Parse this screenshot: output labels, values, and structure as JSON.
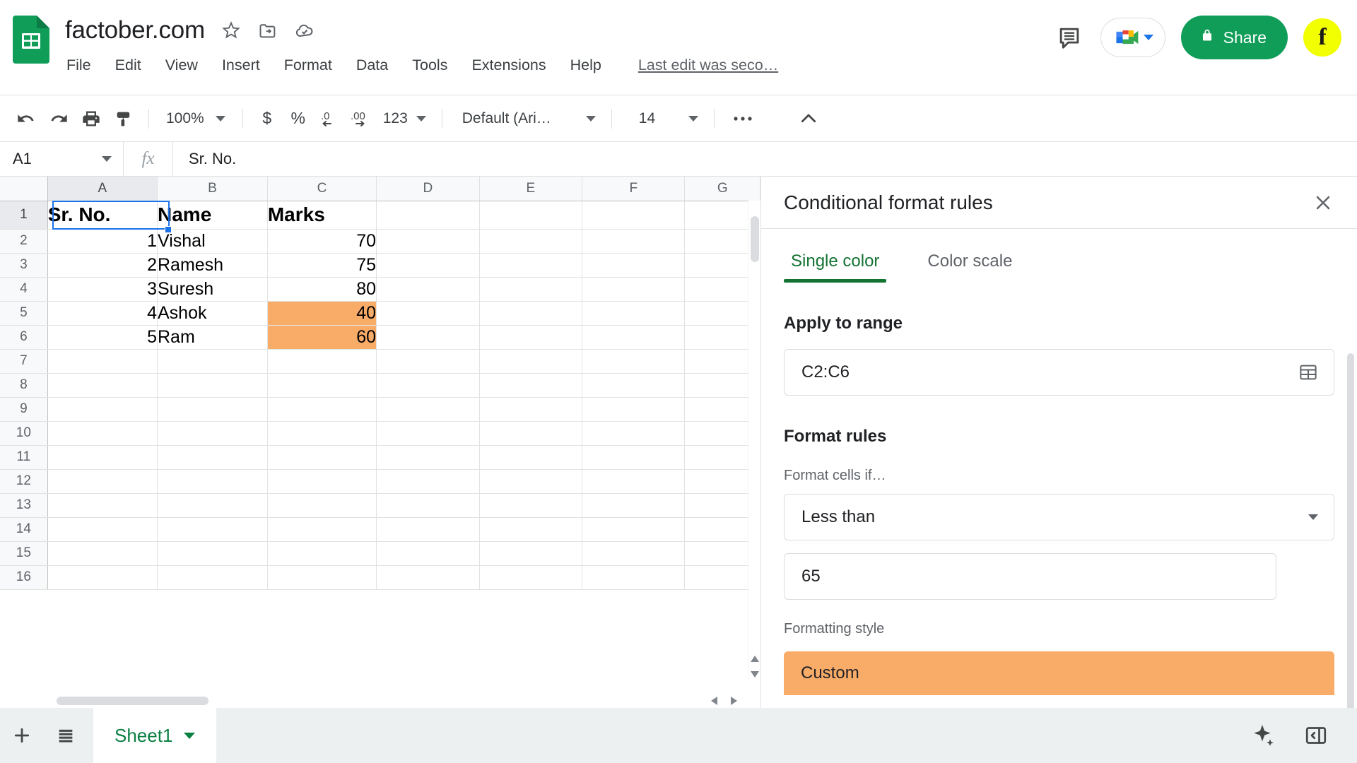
{
  "header": {
    "doc_title": "factober.com",
    "icons": [
      {
        "name": "star-icon",
        "label": "Star"
      },
      {
        "name": "move-to-folder-icon",
        "label": "Move"
      },
      {
        "name": "cloud-saved-icon",
        "label": "Saved to Drive"
      }
    ],
    "menus": [
      "File",
      "Edit",
      "View",
      "Insert",
      "Format",
      "Data",
      "Tools",
      "Extensions",
      "Help"
    ],
    "last_edit": "Last edit was seco…",
    "comment_icon": "comment-icon",
    "meet_icon": "google-meet-icon",
    "share_label": "Share",
    "share_lock_icon": "lock-icon",
    "share_color": "#0f9d58",
    "avatar_initial": "f",
    "avatar_color": "#f2ff00"
  },
  "toolbar": {
    "undo": "undo-icon",
    "redo": "redo-icon",
    "print": "print-icon",
    "paint": "paint-format-icon",
    "zoom_value": "100%",
    "currency": "$",
    "percent": "%",
    "decrease_decimal": ".0",
    "increase_decimal": ".00",
    "more_formats": "123",
    "font_family": "Default (Ari…",
    "font_size": "14",
    "more": "…",
    "collapse": "collapse-toolbar-icon"
  },
  "formula_bar": {
    "name_box": "A1",
    "fx_label": "fx",
    "formula_value": "Sr. No."
  },
  "grid": {
    "columns": [
      "A",
      "B",
      "C",
      "D",
      "E",
      "F",
      "G"
    ],
    "rows": [
      "1",
      "2",
      "3",
      "4",
      "5",
      "6",
      "7",
      "8",
      "9",
      "10",
      "11",
      "12",
      "13",
      "14",
      "15",
      "16"
    ],
    "active_cell": "A1",
    "highlight_color": "#f9ab68",
    "data": [
      {
        "row": "1",
        "a": "Sr. No.",
        "b": "Name",
        "c": "Marks",
        "header": true,
        "hl": false
      },
      {
        "row": "2",
        "a": "1",
        "b": "Vishal",
        "c": "70",
        "header": false,
        "hl": false
      },
      {
        "row": "3",
        "a": "2",
        "b": "Ramesh",
        "c": "75",
        "header": false,
        "hl": false
      },
      {
        "row": "4",
        "a": "3",
        "b": "Suresh",
        "c": "80",
        "header": false,
        "hl": false
      },
      {
        "row": "5",
        "a": "4",
        "b": "Ashok",
        "c": "40",
        "header": false,
        "hl": true
      },
      {
        "row": "6",
        "a": "5",
        "b": "Ram",
        "c": "60",
        "header": false,
        "hl": true
      },
      {
        "row": "7",
        "a": "",
        "b": "",
        "c": "",
        "header": false,
        "hl": false
      },
      {
        "row": "8",
        "a": "",
        "b": "",
        "c": "",
        "header": false,
        "hl": false
      },
      {
        "row": "9",
        "a": "",
        "b": "",
        "c": "",
        "header": false,
        "hl": false
      },
      {
        "row": "10",
        "a": "",
        "b": "",
        "c": "",
        "header": false,
        "hl": false
      },
      {
        "row": "11",
        "a": "",
        "b": "",
        "c": "",
        "header": false,
        "hl": false
      },
      {
        "row": "12",
        "a": "",
        "b": "",
        "c": "",
        "header": false,
        "hl": false
      },
      {
        "row": "13",
        "a": "",
        "b": "",
        "c": "",
        "header": false,
        "hl": false
      },
      {
        "row": "14",
        "a": "",
        "b": "",
        "c": "",
        "header": false,
        "hl": false
      },
      {
        "row": "15",
        "a": "",
        "b": "",
        "c": "",
        "header": false,
        "hl": false
      },
      {
        "row": "16",
        "a": "",
        "b": "",
        "c": "",
        "header": false,
        "hl": false
      }
    ]
  },
  "panel": {
    "title": "Conditional format rules",
    "close_icon": "close-icon",
    "tabs": [
      {
        "label": "Single color",
        "active": true
      },
      {
        "label": "Color scale",
        "active": false
      }
    ],
    "accent_color": "#137333",
    "apply_to_range": {
      "label": "Apply to range",
      "value": "C2:C6",
      "picker_icon": "select-range-icon"
    },
    "format_rules": {
      "label": "Format rules",
      "condition_label": "Format cells if…",
      "condition_value": "Less than",
      "threshold_value": "65"
    },
    "formatting_style": {
      "label": "Formatting style",
      "value": "Custom",
      "swatch_color": "#f9ab68"
    }
  },
  "bottom": {
    "add_sheet_icon": "add-sheet-icon",
    "all_sheets_icon": "all-sheets-icon",
    "sheets": [
      {
        "name": "Sheet1",
        "active": true
      }
    ],
    "explore_icon": "explore-icon",
    "sidebar_expand_icon": "sidebar-expand-icon"
  }
}
